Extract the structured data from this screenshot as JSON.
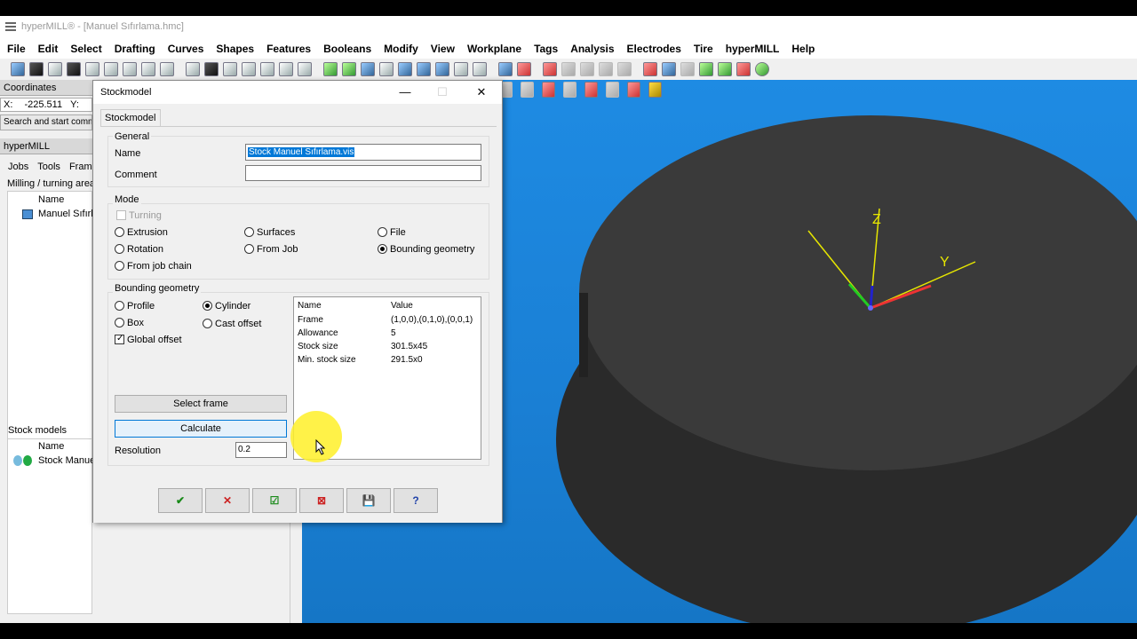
{
  "app": {
    "title": "hyperMILL® - [Manuel Sıfırlama.hmc]"
  },
  "menu": [
    "File",
    "Edit",
    "Select",
    "Drafting",
    "Curves",
    "Shapes",
    "Features",
    "Booleans",
    "Modify",
    "View",
    "Workplane",
    "Tags",
    "Analysis",
    "Electrodes",
    "Tire",
    "hyperMILL",
    "Help"
  ],
  "left_panel": {
    "coordinates_header": "Coordinates",
    "coord_x_label": "X:",
    "coord_x_value": "-225.511",
    "coord_y_label": "Y:",
    "coord_y_value": "-",
    "search_placeholder": "Search and start comm",
    "hypermill_header": "hyperMILL",
    "tabs": [
      "Jobs",
      "Tools",
      "Fram"
    ],
    "areas_label": "Milling / turning areas",
    "list_header_name": "Name",
    "list_item": "Manuel Sıfırla",
    "stock_header": "Stock models",
    "stock_list_header": "Name",
    "stock_item": "Stock Manuel"
  },
  "dialog": {
    "title": "Stockmodel",
    "tab": "Stockmodel",
    "general": {
      "label": "General",
      "name_label": "Name",
      "name_value": "Stock Manuel Sıfırlama.vis",
      "comment_label": "Comment",
      "comment_value": ""
    },
    "mode": {
      "label": "Mode",
      "turning": "Turning",
      "extrusion": "Extrusion",
      "surfaces": "Surfaces",
      "file": "File",
      "rotation": "Rotation",
      "from_job": "From Job",
      "bounding_geometry": "Bounding geometry",
      "from_job_chain": "From job chain"
    },
    "bounding": {
      "label": "Bounding geometry",
      "profile": "Profile",
      "cylinder": "Cylinder",
      "box": "Box",
      "cast_offset": "Cast offset",
      "global_offset": "Global offset",
      "select_frame": "Select frame",
      "calculate": "Calculate",
      "resolution_label": "Resolution",
      "resolution_value": "0.2"
    },
    "table": {
      "col_name": "Name",
      "col_value": "Value",
      "rows": [
        {
          "name": "Frame",
          "value": "(1,0,0),(0,1,0),(0,0,1)"
        },
        {
          "name": "Allowance",
          "value": "5"
        },
        {
          "name": "Stock size",
          "value": "301.5x45"
        },
        {
          "name": "Min. stock size",
          "value": "291.5x0"
        }
      ]
    },
    "footer_buttons": [
      "✔",
      "✕",
      "☑",
      "⊠",
      "💾",
      "?"
    ]
  },
  "colors": {
    "viewport_bg": "#1a7fd4",
    "stock_body": "#3a3a3a",
    "axis_yellow": "#e6e600",
    "selection_blue": "#0078d7"
  }
}
